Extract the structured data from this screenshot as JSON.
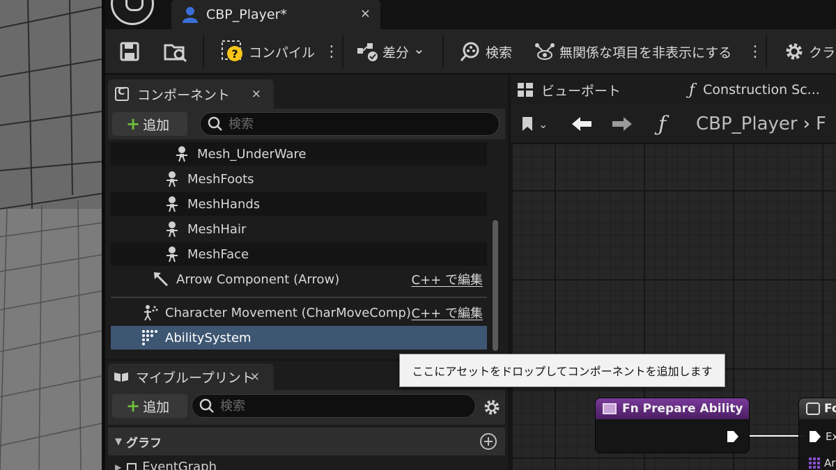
{
  "window": {
    "tab_title": "CBP_Player*",
    "tab_close": "×"
  },
  "toolbar": {
    "compile_label": "コンパイル",
    "diff_label": "差分",
    "find_label": "検索",
    "hide_unrelated_label": "無関係な項目を非表示にする",
    "class_settings_label": "クラ",
    "kebab": "⋮",
    "dropdown_glyph": "⌄"
  },
  "components": {
    "tab_label": "コンポーネント",
    "close": "×",
    "add_label": "追加",
    "search_placeholder": "検索",
    "items": [
      {
        "label": "Mesh_UnderWare",
        "edit": ""
      },
      {
        "label": "MeshFoots",
        "edit": ""
      },
      {
        "label": "MeshHands",
        "edit": ""
      },
      {
        "label": "MeshHair",
        "edit": ""
      },
      {
        "label": "MeshFace",
        "edit": ""
      },
      {
        "label": "Arrow Component (Arrow)",
        "edit": "C++ で編集"
      },
      {
        "label": "Character Movement (CharMoveComp)",
        "edit": "C++ で編集"
      },
      {
        "label": "AbilitySystem",
        "edit": ""
      }
    ]
  },
  "my_blueprint": {
    "tab_label": "マイブループリント",
    "close": "×",
    "add_label": "追加",
    "search_placeholder": "検索",
    "graph_header": "グラフ",
    "graph_item": "EventGraph"
  },
  "graph": {
    "viewport_tab": "ビューポート",
    "construction_tab": "Construction Sc...",
    "breadcrumb_root": "CBP_Player",
    "breadcrumb_sep": "›",
    "breadcrumb_next": "F",
    "node_title": "Fn Prepare Ability",
    "node2_title": "Fo",
    "node2_pin_exec": "Ex",
    "node2_pin_2": "Ar"
  },
  "tooltip": {
    "text": "ここにアセットをドロップしてコンポーネントを追加します"
  },
  "colors": {
    "selection": "#3d5672",
    "add_plus": "#6fbf3a",
    "node_header": "#7a3a9a",
    "compile_warning": "#f5c518"
  }
}
